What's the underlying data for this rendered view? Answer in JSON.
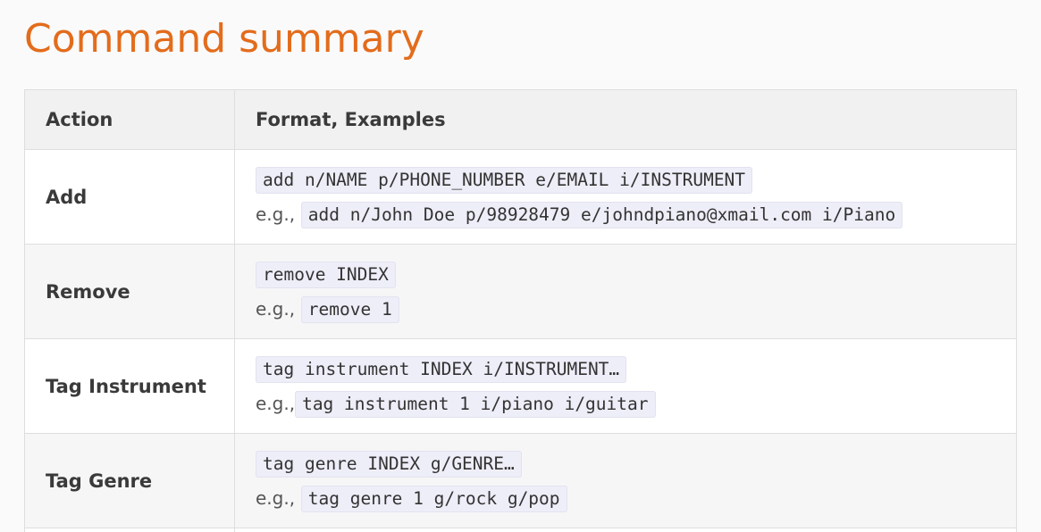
{
  "title": "Command summary",
  "table": {
    "headers": [
      "Action",
      "Format, Examples"
    ],
    "rows": [
      {
        "action": "Add",
        "format": "add n/NAME p/PHONE_NUMBER e/EMAIL i/INSTRUMENT",
        "example_prefix": "e.g.,",
        "example": "add n/John Doe p/98928479 e/johndpiano@xmail.com i/Piano"
      },
      {
        "action": "Remove",
        "format": "remove INDEX",
        "example_prefix": "e.g.,",
        "example": "remove 1"
      },
      {
        "action": "Tag Instrument",
        "format": "tag instrument INDEX i/INSTRUMENT…",
        "example_prefix": "e.g.,",
        "example": "tag instrument 1 i/piano i/guitar"
      },
      {
        "action": "Tag Genre",
        "format": "tag genre INDEX g/GENRE…",
        "example_prefix": "e.g.,",
        "example": "tag genre 1 g/rock g/pop"
      }
    ]
  }
}
